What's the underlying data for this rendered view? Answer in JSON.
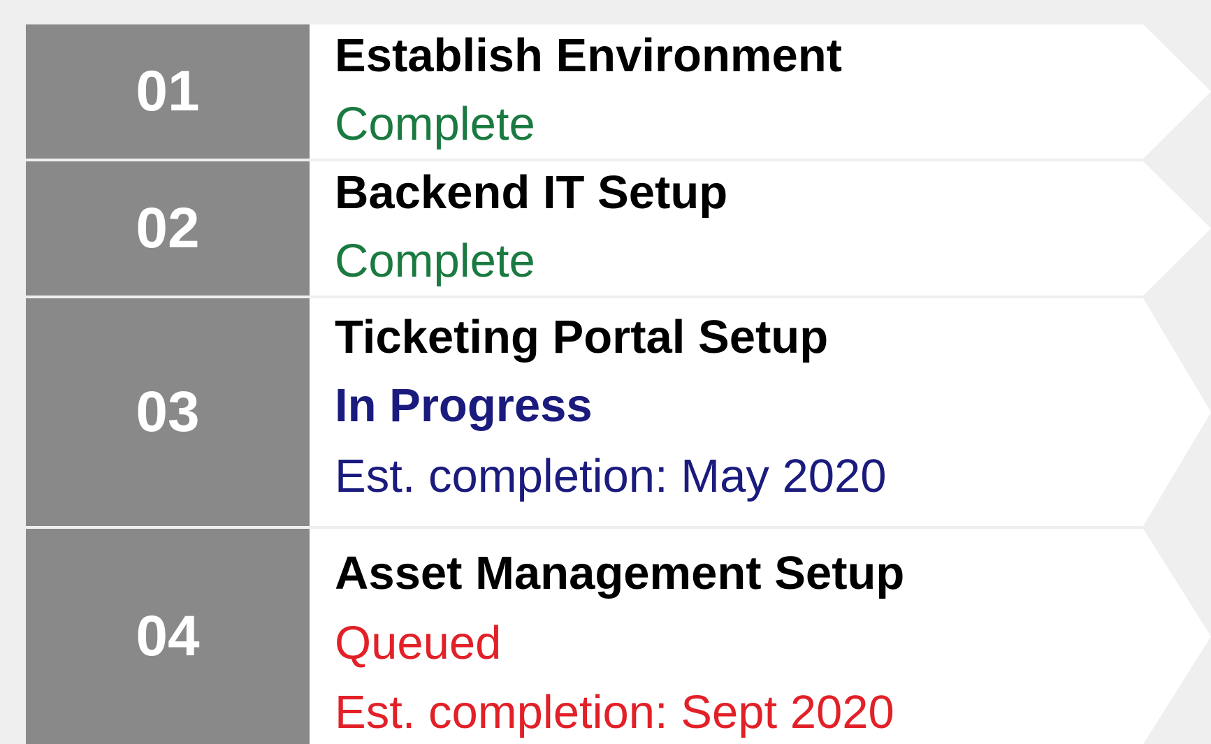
{
  "colors": {
    "background": "#efefef",
    "number_box": "#898989",
    "arrow": "#ffffff",
    "complete": "#1a7a40",
    "in_progress": "#1b1b7e",
    "queued": "#e22028"
  },
  "steps": [
    {
      "number": "01",
      "title": "Establish Environment",
      "status": "Complete"
    },
    {
      "number": "02",
      "title": "Backend IT Setup",
      "status": "Complete"
    },
    {
      "number": "03",
      "title": "Ticketing Portal Setup",
      "status": "In Progress",
      "note": "Est. completion: May 2020"
    },
    {
      "number": "04",
      "title": "Asset Management Setup",
      "status": "Queued",
      "note": "Est. completion: Sept 2020"
    }
  ]
}
